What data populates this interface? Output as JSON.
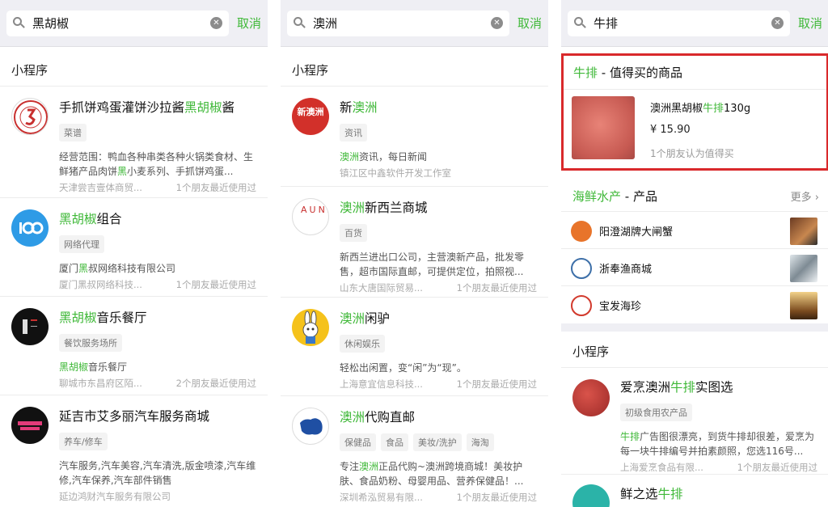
{
  "panels": [
    {
      "query": "黑胡椒",
      "cancel": "取消",
      "section": "小程序",
      "items": [
        {
          "name_pre": "手抓饼鸡蛋灌饼沙拉酱",
          "name_hl": "黑胡椒",
          "name_post": "酱",
          "tags": [
            "菜谱"
          ],
          "desc_pre": "经营范围：鸭血各种串类各种火锅类食材、生鲜猪产品肉饼",
          "desc_hl": "黑",
          "desc_post": "小麦系列、手抓饼鸡蛋...",
          "owner": "天津尝吉壹体商贸...",
          "friends": "1个朋友最近使用过"
        },
        {
          "name_pre": "",
          "name_hl": "黑胡椒",
          "name_post": "组合",
          "tags": [
            "网络代理"
          ],
          "desc_pre": "厦门",
          "desc_hl": "黑",
          "desc_post": "叔网络科技有限公司",
          "owner": "厦门黑叔网络科技...",
          "friends": "1个朋友最近使用过"
        },
        {
          "name_pre": "",
          "name_hl": "黑胡椒",
          "name_post": "音乐餐厅",
          "tags": [
            "餐饮服务场所"
          ],
          "desc_pre": "",
          "desc_hl": "黑胡椒",
          "desc_post": "音乐餐厅",
          "owner": "聊城市东昌府区陌...",
          "friends": "2个朋友最近使用过"
        },
        {
          "name_pre": "延吉市艾多丽汽车服务商城",
          "name_hl": "",
          "name_post": "",
          "tags": [
            "养车/修车"
          ],
          "desc_pre": "汽车服务,汽车美容,汽车清洗,版金喷漆,汽车维修,汽车保养,汽车部件销售",
          "desc_hl": "",
          "desc_post": "",
          "owner": "延边鸿财汽车服务有限公司",
          "friends": ""
        }
      ]
    },
    {
      "query": "澳洲",
      "cancel": "取消",
      "section": "小程序",
      "items": [
        {
          "name_pre": "新",
          "name_hl": "澳洲",
          "name_post": "",
          "tags": [
            "资讯"
          ],
          "desc_pre": "",
          "desc_hl": "澳洲",
          "desc_post": "资讯，每日新闻",
          "owner": "镇江区中鑫软件开发工作室",
          "friends": "",
          "avatar_text": "新澳洲"
        },
        {
          "name_pre": "",
          "name_hl": "澳洲",
          "name_post": "新西兰商城",
          "tags": [
            "百货"
          ],
          "desc_pre": "新西兰进出口公司，主营澳新产品，批发零售，超市国际直邮，可提供定位，拍照视...",
          "desc_hl": "",
          "desc_post": "",
          "owner": "山东大唐国际贸易...",
          "friends": "1个朋友最近使用过",
          "avatar_text": "AUNZ"
        },
        {
          "name_pre": "",
          "name_hl": "澳洲",
          "name_post": "闲驴",
          "tags": [
            "休闲娱乐"
          ],
          "desc_pre": "轻松出闲置，变“闲”为“现”。",
          "desc_hl": "",
          "desc_post": "",
          "owner": "上海意宜信息科技...",
          "friends": "1个朋友最近使用过"
        },
        {
          "name_pre": "",
          "name_hl": "澳洲",
          "name_post": "代购直邮",
          "tags": [
            "保健品",
            "食品",
            "美妆/洗护",
            "海淘"
          ],
          "desc_pre": "专注",
          "desc_hl": "澳洲",
          "desc_post": "正品代购~澳洲跨境商城！美妆护肤、食品奶粉、母婴用品、营养保健品！...",
          "owner": "深圳希泓贸易有限...",
          "friends": "1个朋友最近使用过"
        }
      ]
    },
    {
      "query": "牛排",
      "cancel": "取消",
      "goods": {
        "title_hl": "牛排",
        "title_rest": " - 值得买的商品",
        "name_pre": "澳洲黑胡椒",
        "name_hl": "牛排",
        "name_post": "130g",
        "price": "¥ 15.90",
        "note": "1个朋友认为值得买"
      },
      "seafood": {
        "title_hl": "海鲜水产",
        "title_rest": " - 产品",
        "more": "更多",
        "shops": [
          "阳澄湖牌大闸蟹",
          "浙奉渔商城",
          "宝发海珍"
        ]
      },
      "section": "小程序",
      "items": [
        {
          "name_pre": "爱烹澳洲",
          "name_hl": "牛排",
          "name_post": "实图选",
          "tags": [
            "初级食用农产品"
          ],
          "desc_pre": "",
          "desc_hl": "牛排",
          "desc_post": "广告图很漂亮，到货牛排却很差，爱烹为每一块牛排编号并拍素颜照，您选116号...",
          "owner": "上海爱烹食品有限...",
          "friends": "1个朋友最近使用过"
        },
        {
          "name_pre": "鲜之选",
          "name_hl": "牛排",
          "name_post": "",
          "tags": [],
          "desc_pre": "",
          "desc_hl": "",
          "desc_post": "",
          "owner": "",
          "friends": ""
        }
      ]
    }
  ],
  "colors": {
    "highlight": "#3fb838",
    "frame": "#d9292b"
  }
}
